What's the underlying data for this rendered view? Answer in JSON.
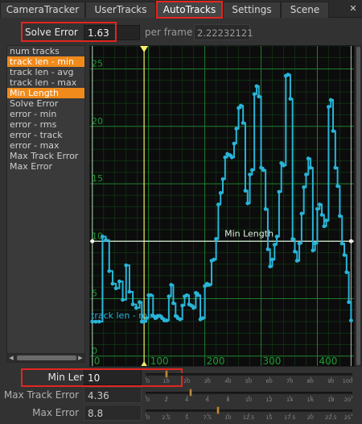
{
  "tabs": [
    {
      "label": "CameraTracker",
      "active": false,
      "name": "tab-cameratracker"
    },
    {
      "label": "UserTracks",
      "active": false,
      "name": "tab-usertracks"
    },
    {
      "label": "AutoTracks",
      "active": true,
      "name": "tab-autotracks"
    },
    {
      "label": "Settings",
      "active": false,
      "name": "tab-settings"
    },
    {
      "label": "Scene",
      "active": false,
      "name": "tab-scene"
    }
  ],
  "close_icon": "close-icon",
  "solve": {
    "label": "Solve Error",
    "value": "1.63",
    "per_frame_label": "per frame",
    "per_frame_value": "2.22232121"
  },
  "list_items": [
    {
      "label": "num tracks",
      "selected": false
    },
    {
      "label": "track len - min",
      "selected": true
    },
    {
      "label": "track len - avg",
      "selected": false
    },
    {
      "label": "track len - max",
      "selected": false
    },
    {
      "label": "Min Length",
      "selected": true
    },
    {
      "label": "Solve Error",
      "selected": false
    },
    {
      "label": "error - min",
      "selected": false
    },
    {
      "label": "error - rms",
      "selected": false
    },
    {
      "label": "error - track",
      "selected": false
    },
    {
      "label": "error - max",
      "selected": false
    },
    {
      "label": "Max Track Error",
      "selected": false
    },
    {
      "label": "Max Error",
      "selected": false
    }
  ],
  "chart_data": {
    "type": "line",
    "x_ticks": [
      0,
      100,
      200,
      300,
      400
    ],
    "y_ticks": [
      0,
      5,
      10,
      15,
      20,
      25
    ],
    "xlim": [
      -4,
      468
    ],
    "ylim": [
      -1,
      27
    ],
    "current_frame": 92,
    "series": [
      {
        "name": "track len - min",
        "color": "#29b4d8",
        "x": [
          0,
          6,
          12,
          18,
          24,
          30,
          36,
          42,
          48,
          54,
          60,
          66,
          72,
          78,
          84,
          88,
          92,
          96,
          100,
          104,
          108,
          112,
          116,
          120,
          124,
          128,
          132,
          136,
          140,
          144,
          148,
          152,
          156,
          160,
          164,
          168,
          172,
          176,
          180,
          184,
          188,
          192,
          196,
          200,
          204,
          208,
          212,
          216,
          220,
          224,
          228,
          232,
          236,
          240,
          244,
          248,
          252,
          256,
          260,
          264,
          268,
          272,
          276,
          280,
          284,
          288,
          292,
          296,
          300,
          304,
          308,
          312,
          316,
          320,
          324,
          328,
          332,
          336,
          340,
          344,
          348,
          352,
          356,
          360,
          364,
          368,
          372,
          376,
          380,
          384,
          388,
          392,
          396,
          400,
          404,
          408,
          412,
          416,
          420,
          424,
          428,
          432,
          436,
          440,
          444,
          448,
          452,
          456,
          460
        ],
        "y": [
          3,
          3,
          3,
          10.4,
          10.1,
          7.4,
          6.3,
          5.9,
          6.5,
          4.9,
          7.9,
          5.6,
          4.5,
          4.2,
          4.7,
          3,
          3,
          3.3,
          5.3,
          5.3,
          3.5,
          3.3,
          3.5,
          3.5,
          3.3,
          3.1,
          3.1,
          5.2,
          6.2,
          4.6,
          3.5,
          3.3,
          3.2,
          4.4,
          5.2,
          5.3,
          4.5,
          4.4,
          4.2,
          5.5,
          5.3,
          3.2,
          3.3,
          6.1,
          6.3,
          6.2,
          8.3,
          8.4,
          10.2,
          13.2,
          14.2,
          15.4,
          17.3,
          17.6,
          17.5,
          17.3,
          18.5,
          19.8,
          21.6,
          21.8,
          20.3,
          14.4,
          13.3,
          15.8,
          16.2,
          22.8,
          23.5,
          22.6,
          16.4,
          16.2,
          12.8,
          9.3,
          7.8,
          8.4,
          9.7,
          10.4,
          14.3,
          16.8,
          16.6,
          24.4,
          24.5,
          22.4,
          10.2,
          9.1,
          8.3,
          9.8,
          12.4,
          14.7,
          15.8,
          17.2,
          16.4,
          9.2,
          9.8,
          12.8,
          13.2,
          12.3,
          11.3,
          11.8,
          21.7,
          22.3,
          19.6,
          16.4,
          14.8,
          12.2,
          9.8,
          8.8,
          7.3,
          4.7,
          3.1
        ]
      },
      {
        "name": "Min Length",
        "color": "#dcebdc",
        "constant": 10
      }
    ],
    "annotations": [
      {
        "text": "Min Length",
        "color": "#dcebdc"
      },
      {
        "text": "track len - min",
        "color": "#29b4d8"
      }
    ]
  },
  "params": {
    "min_length": {
      "label": "Min Length",
      "value": "10",
      "fraction": 0.1
    },
    "max_track_error": {
      "label": "Max Track Error",
      "value": "4.36",
      "fraction": 0.218
    },
    "max_error": {
      "label": "Max Error",
      "value": "8.8",
      "fraction": 0.352
    }
  },
  "slider_scales": {
    "min_length": [
      "0",
      "10",
      "20",
      "30",
      "40",
      "50",
      "60",
      "70",
      "80",
      "90",
      "100"
    ],
    "max_track_error": [
      "0",
      "2",
      "4",
      "6",
      "8",
      "10",
      "12",
      "14",
      "16",
      "18",
      "20"
    ],
    "max_error": [
      "0",
      "2.5",
      "5",
      "7.5",
      "10",
      "12.5",
      "15",
      "17.5",
      "20",
      "22.5",
      "25"
    ]
  },
  "colors": {
    "accent_selected": "#f08a1a",
    "highlight_box": "#e3261f",
    "grid": "#135e1e",
    "track_series": "#29b4d8",
    "threshold_line": "#dcebdc",
    "frame_marker": "#f5ee6a"
  }
}
